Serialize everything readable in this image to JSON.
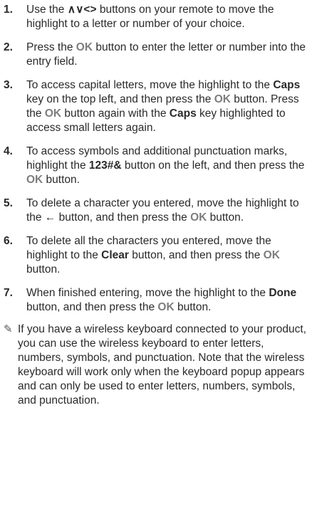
{
  "steps": [
    {
      "num": "1.",
      "parts": [
        {
          "t": "Use the "
        },
        {
          "t": "∧∨<>",
          "s": "b"
        },
        {
          "t": " buttons on your remote to move the highlight to a letter or number of your choice."
        }
      ]
    },
    {
      "num": "2.",
      "parts": [
        {
          "t": "Press the "
        },
        {
          "t": "OK",
          "s": "ok"
        },
        {
          "t": " button to enter the letter or number into the entry field."
        }
      ]
    },
    {
      "num": "3.",
      "parts": [
        {
          "t": "To access capital letters, move the highlight to the "
        },
        {
          "t": "Caps",
          "s": "b"
        },
        {
          "t": " key on the top left, and then press the "
        },
        {
          "t": "OK",
          "s": "ok"
        },
        {
          "t": " button. Press the "
        },
        {
          "t": "OK",
          "s": "ok"
        },
        {
          "t": " button again with the "
        },
        {
          "t": "Caps",
          "s": "b"
        },
        {
          "t": " key highlighted to access small letters again."
        }
      ]
    },
    {
      "num": "4.",
      "parts": [
        {
          "t": "To access symbols and additional punctuation marks, highlight the "
        },
        {
          "t": "123#&",
          "s": "b"
        },
        {
          "t": " button on the left, and then press the "
        },
        {
          "t": "OK",
          "s": "ok"
        },
        {
          "t": " button."
        }
      ]
    },
    {
      "num": "5.",
      "parts": [
        {
          "t": "To delete a character you entered, move the highlight to the "
        },
        {
          "t": "←",
          "s": "b"
        },
        {
          "t": " button, and then press the "
        },
        {
          "t": "OK",
          "s": "ok"
        },
        {
          "t": " button."
        }
      ]
    },
    {
      "num": "6.",
      "parts": [
        {
          "t": "To delete all the characters you entered, move the highlight to the "
        },
        {
          "t": "Clear",
          "s": "b"
        },
        {
          "t": " button, and then press the "
        },
        {
          "t": "OK",
          "s": "ok"
        },
        {
          "t": " button."
        }
      ]
    },
    {
      "num": "7.",
      "parts": [
        {
          "t": "When finished entering, move the highlight to the "
        },
        {
          "t": "Done",
          "s": "b"
        },
        {
          "t": " button, and then press the "
        },
        {
          "t": "OK",
          "s": "ok"
        },
        {
          "t": " button."
        }
      ]
    }
  ],
  "note": {
    "icon": "pencil-note-icon",
    "glyph": "✎",
    "text": "If you have a wireless keyboard connected to your product, you can use the wireless keyboard to enter letters, numbers, symbols, and punctuation. Note that the wireless keyboard will work only when the keyboard popup appears and can only be used to enter letters, numbers, symbols, and punctuation."
  },
  "colors": {
    "ok": "#7d7d7d",
    "text": "#2a2a2a"
  }
}
